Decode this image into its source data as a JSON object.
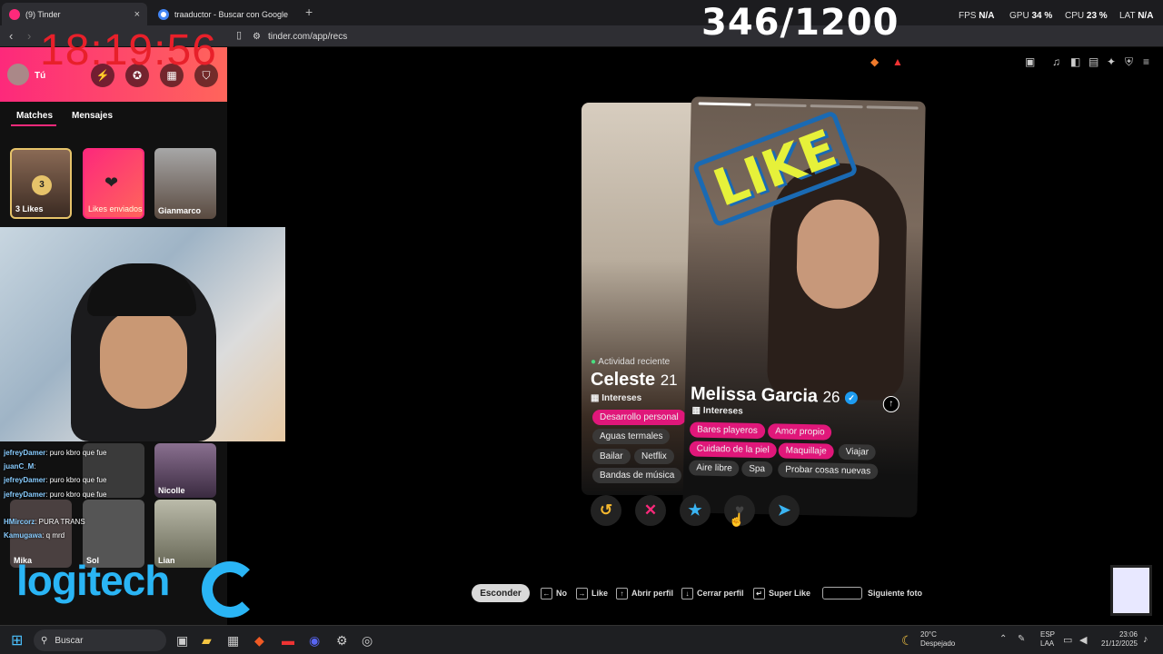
{
  "browser": {
    "tabs": [
      {
        "label": "(9) Tinder",
        "active": true
      },
      {
        "label": "traaductor - Buscar con Google",
        "active": false
      }
    ],
    "url": "tinder.com/app/recs"
  },
  "overlay": {
    "counter": "346/1200",
    "clock": "18:19:56",
    "fps_label": "FPS",
    "fps_value": "N/A",
    "gpu_label": "GPU",
    "gpu_value": "34 %",
    "cpu_label": "CPU",
    "cpu_value": "23 %",
    "lat_label": "LAT",
    "lat_value": "N/A"
  },
  "sidebar": {
    "me_label": "Tú",
    "tabs": [
      "Matches",
      "Mensajes"
    ],
    "likes_count": "3",
    "likes_label": "3 Likes",
    "sent_label": "Likes enviados",
    "match_name": "Gianmarco",
    "grid_names": [
      "Nicolle",
      "Mika",
      "Sol",
      "Lian"
    ]
  },
  "chat": [
    {
      "user": "jefreyDamer",
      "text": ": puro kbro que fue"
    },
    {
      "user": "juanC_M",
      "text": ":"
    },
    {
      "user": "jefreyDamer",
      "text": ": puro kbro que fue"
    },
    {
      "user": "jefreyDamer",
      "text": ": puro kbro que fue"
    },
    {
      "user": "HMircorz",
      "text": ": PURA TRANS"
    },
    {
      "user": "Kamugawa",
      "text": ": q mrd"
    }
  ],
  "logo_text": "logitech",
  "cards": {
    "back": {
      "activity": "Actividad reciente",
      "name": "Celeste",
      "age": "21",
      "interests_label": "Intereses",
      "chips": [
        "Desarrollo personal",
        "Aguas termales",
        "Bailar",
        "Netflix",
        "Bandas de música"
      ]
    },
    "front": {
      "stamp": "LIKE",
      "name": "Melissa Garcia",
      "age": "26",
      "interests_label": "Intereses",
      "chips": [
        "Bares playeros",
        "Amor propio",
        "Cuidado de la piel",
        "Maquillaje",
        "Viajar",
        "Aire libre",
        "Spa",
        "Probar cosas nuevas"
      ]
    }
  },
  "actions": {
    "rewind": "↺",
    "nope": "✕",
    "super": "★",
    "like": "♥",
    "boost": "➤"
  },
  "shortcuts": {
    "hide": "Esconder",
    "no": "No",
    "like": "Like",
    "open": "Abrir perfil",
    "close": "Cerrar perfil",
    "super": "Super Like",
    "next": "Siguiente foto"
  },
  "taskbar": {
    "search": "Buscar",
    "weather_temp": "20°C",
    "weather_desc": "Despejado",
    "lang1": "ESP",
    "lang2": "LAA",
    "time": "23:06",
    "date": "21/12/2025"
  },
  "colors": {
    "tinder_pink": "#fd297b",
    "tinder_orange": "#ff655b",
    "logitech_blue": "#2ab5f5",
    "clock_red": "#e8202a"
  }
}
